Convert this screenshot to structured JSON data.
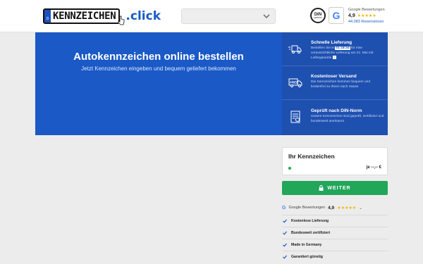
{
  "header": {
    "logo_plate_text": "KENNZEICHEN",
    "logo_suffix": ".click",
    "plate_country": "D",
    "select_value": "",
    "din_badge_text": "DIN",
    "din_badge_sub": "GEPRÜFT",
    "google_rating": {
      "label": "Google Bewertungen",
      "score": "4,9",
      "stars": "★★★★★",
      "count": "44.083 Rezensionen"
    }
  },
  "hero": {
    "title": "Autokennzeichen online bestellen",
    "subtitle": "Jetzt Kennzeichen eingeben und bequem geliefert bekommen",
    "features": [
      {
        "title": "Schnelle Lieferung",
        "desc_before": "Bestellen Sie in",
        "timer": "01:18:34",
        "desc_after": "für eine voraussichtliche Lieferung am 21. Mai mit Liefergarantie",
        "icon": "truck-fast-icon"
      },
      {
        "title": "Kostenloser Versand",
        "desc": "Die Kennzeichen kommen bequem und kostenfrei zu Ihnen nach Hause",
        "icon": "free-shipping-icon"
      },
      {
        "title": "Geprüft nach DIN-Norm",
        "desc": "Unsere Kennzeichen sind geprüft, zertifiziert und bundesweit anerkannt",
        "icon": "certificate-icon"
      }
    ]
  },
  "sidebar": {
    "plate_card_title": "Ihr Kennzeichen",
    "price": "je --,-- €",
    "cta_label": "WEITER",
    "rating": {
      "label": "Google Bewertungen",
      "score": "4,9",
      "stars": "★★★★★"
    },
    "checklist": [
      "Kostenlose Lieferung",
      "Bundesweit zertifiziert",
      "Made in Germany",
      "Garantiert günstig"
    ]
  },
  "colors": {
    "brand_blue": "#1a59c6",
    "feature_panel": "#1e50b0",
    "cta_green": "#21a65a",
    "star_yellow": "#f3b400"
  }
}
